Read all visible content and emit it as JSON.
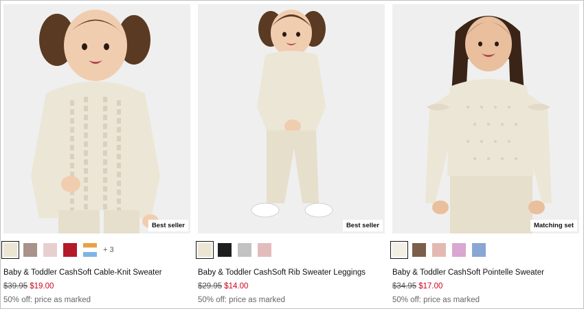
{
  "products": [
    {
      "badge": "Best seller",
      "title": "Baby & Toddler CashSoft Cable-Knit Sweater",
      "old_price": "$39.95",
      "new_price": "$19.00",
      "promo": "50% off: price as marked",
      "more_colors": "+ 3",
      "swatches": [
        "#ece5d3",
        "#a9928a",
        "#e8cfcf",
        "#b21a2a",
        "stripe"
      ]
    },
    {
      "badge": "Best seller",
      "title": "Baby & Toddler CashSoft Rib Sweater Leggings",
      "old_price": "$29.95",
      "new_price": "$14.00",
      "promo": "50% off: price as marked",
      "swatches": [
        "#ece5d3",
        "#1e1e1e",
        "#c2c2c2",
        "#e2bcbc"
      ]
    },
    {
      "badge": "Matching set",
      "title": "Baby & Toddler CashSoft Pointelle Sweater",
      "old_price": "$34.95",
      "new_price": "$17.00",
      "promo": "50% off: price as marked",
      "swatches": [
        "#f3efe4",
        "#7a5f4c",
        "#e4b9b2",
        "#d9a7d0",
        "#8aa7d4"
      ]
    }
  ],
  "colors": {
    "sale": "#d0021b",
    "photo_bg": "#efefef",
    "sweater": "#ece6d6"
  }
}
